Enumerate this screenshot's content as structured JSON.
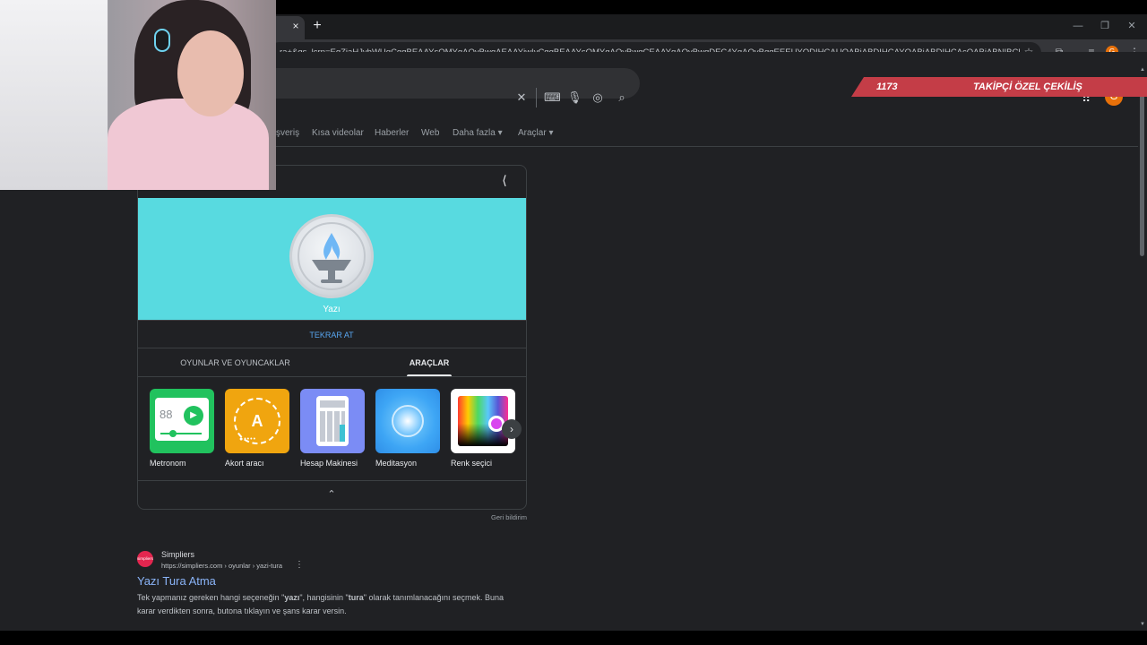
{
  "browser": {
    "tab_close_glyph": "×",
    "new_tab_glyph": "+",
    "url": "ra+&gs_lcrp=EgZjaHJvbWUqCggBEAAYsQMYgAQyBwgAEAAYjwIyCggBEAAYsQMYgAQyBwgCEAAYgAQyBwgDEC4YgAQyBggEEEUYQDIHCAUQABiABDIHCAYQABiABDIHCAcQABiABNIBCDI2NTRqMGo3...",
    "profile_letter": "G"
  },
  "search": {
    "apps_glyph": "⋮⋮⋮",
    "avatar_letter": "G"
  },
  "nav": {
    "items": [
      {
        "label": "şveriş"
      },
      {
        "label": "Kısa videolar"
      },
      {
        "label": "Haberler"
      },
      {
        "label": "Web"
      },
      {
        "label": "Daha fazla ▾"
      },
      {
        "label": "Araçlar ▾"
      }
    ]
  },
  "coin_card": {
    "result": "Yazı",
    "retry_label": "TEKRAR AT",
    "tabs": [
      {
        "label": "OYUNLAR VE OYUNCAKLAR",
        "active": false
      },
      {
        "label": "ARAÇLAR",
        "active": true
      }
    ],
    "tools": [
      {
        "label": "Metronom",
        "icon": "metronome-icon",
        "color": "#21c25e",
        "display": "88"
      },
      {
        "label": "Akort aracı",
        "icon": "tuner-icon",
        "color": "#f0a50f",
        "display": "A"
      },
      {
        "label": "Hesap Makinesi",
        "icon": "calculator-icon",
        "color": "#7b8cf5"
      },
      {
        "label": "Meditasyon",
        "icon": "meditation-icon",
        "color": "#3ea6f5"
      },
      {
        "label": "Renk seçici",
        "icon": "color-picker-icon",
        "color": "#ffffff"
      }
    ],
    "feedback_label": "Geri bildirim",
    "collapse_glyph": "⌃",
    "next_glyph": "›"
  },
  "result": {
    "favicon_text": "simpliers",
    "site_name": "Simpliers",
    "site_url": "https://simpliers.com › oyunlar › yazi-tura",
    "title": "Yazı Tura Atma",
    "snippet_1": "Tek yapmanız gereken hangi seçeneğin \"",
    "snippet_b1": "yazı",
    "snippet_2": "\", hangisinin \"",
    "snippet_b2": "tura",
    "snippet_3": "\" olarak tanımlanacağını seçmek. Buna karar verdikten sonra, butona tıklayın ve şans karar versin."
  },
  "overlay": {
    "count": "1173",
    "title": "TAKİPÇİ ÖZEL ÇEKİLİŞ"
  },
  "colors": {
    "coin_bg": "#58dae0",
    "banner": "#c43d47",
    "link": "#8ab4f8"
  }
}
